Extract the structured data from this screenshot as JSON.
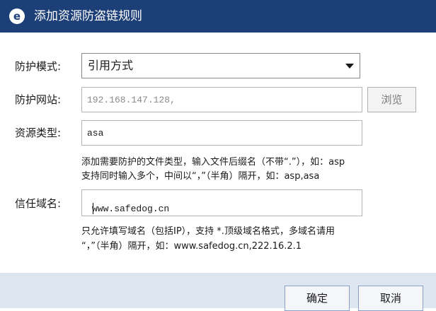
{
  "window": {
    "title": "添加资源防盗链规则",
    "icon": "e-logo-icon"
  },
  "form": {
    "mode": {
      "label": "防护模式:",
      "value": "引用方式"
    },
    "site": {
      "label": "防护网站:",
      "value": "192.168.147.128,",
      "browse_label": "浏览"
    },
    "type": {
      "label": "资源类型:",
      "value": "asa",
      "hint_line1": "添加需要防护的文件类型，输入文件后缀名（不带“.”），如：asp",
      "hint_line2": "支持同时输入多个，中间以“，”（半角）隔开，如：asp,asa"
    },
    "domain": {
      "label": "信任域名:",
      "value": "www.safedog.cn",
      "hint_line1": "只允许填写域名（包括IP），支持 *.顶级域名格式，多域名请用",
      "hint_line2": "“，”（半角）隔开，如：www.safedog.cn,222.16.2.1"
    }
  },
  "buttons": {
    "ok_label": "确定",
    "cancel_label": "取消"
  }
}
